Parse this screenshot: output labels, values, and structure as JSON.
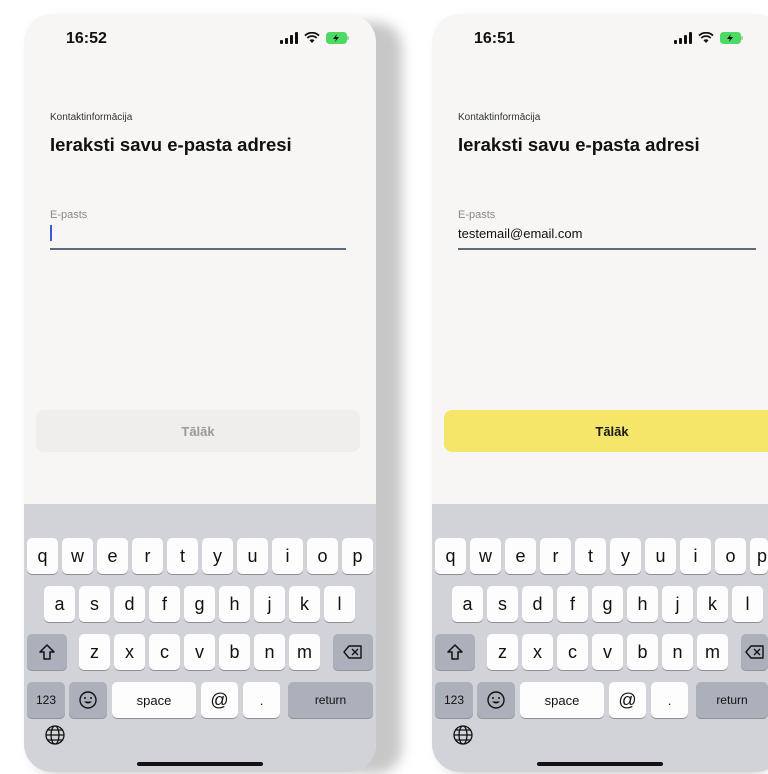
{
  "screens": [
    {
      "id": "empty",
      "status_time": "16:52",
      "eyebrow": "Kontaktinformācija",
      "heading": "Ieraksti savu e-pasta adresi",
      "field_label": "E-pasts",
      "field_value": "",
      "button_label": "Tālāk",
      "button_state": "disabled"
    },
    {
      "id": "filled",
      "status_time": "16:51",
      "eyebrow": "Kontaktinformācija",
      "heading": "Ieraksti savu e-pasta adresi",
      "field_label": "E-pasts",
      "field_value": "testemail@email.com",
      "button_label": "Tālāk",
      "button_state": "enabled"
    }
  ],
  "keyboard": {
    "row1": [
      "q",
      "w",
      "e",
      "r",
      "t",
      "y",
      "u",
      "i",
      "o",
      "p"
    ],
    "row2": [
      "a",
      "s",
      "d",
      "f",
      "g",
      "h",
      "j",
      "k",
      "l"
    ],
    "row3": [
      "z",
      "x",
      "c",
      "v",
      "b",
      "n",
      "m"
    ],
    "numbers_label": "123",
    "space_label": "space",
    "at_label": "@",
    "dot_label": ".",
    "return_label": "return"
  },
  "colors": {
    "accent_button": "#f5e66a",
    "disabled_button": "#efeeec",
    "caret": "#3b5bd8"
  }
}
